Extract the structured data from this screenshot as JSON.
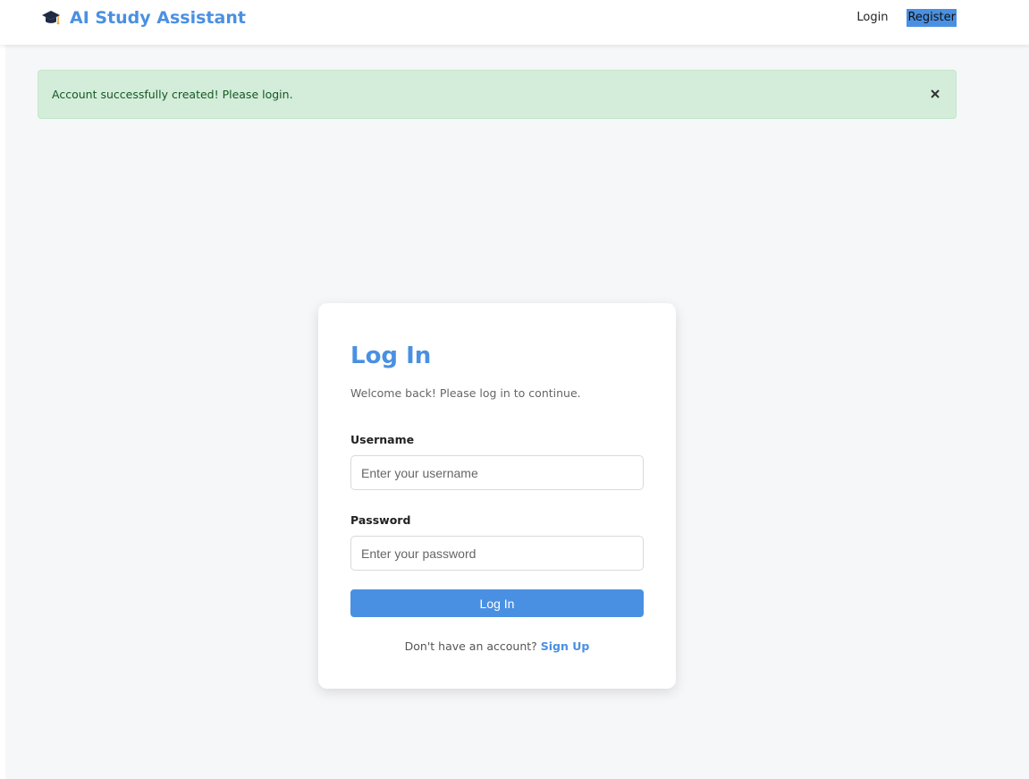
{
  "navbar": {
    "brand": "AI Study Assistant",
    "brand_icon": "graduation-cap-icon",
    "login_label": "Login",
    "register_label": "Register"
  },
  "alert": {
    "message": "Account successfully created! Please login.",
    "close_icon": "close-icon",
    "type": "success"
  },
  "login_form": {
    "title": "Log In",
    "subtitle": "Welcome back! Please log in to continue.",
    "username_label": "Username",
    "username_placeholder": "Enter your username",
    "username_value": "",
    "password_label": "Password",
    "password_placeholder": "Enter your password",
    "password_value": "",
    "submit_label": "Log In",
    "signup_prompt": "Don't have an account?",
    "signup_link": "Sign Up"
  },
  "colors": {
    "accent": "#4a90e2",
    "alert_bg": "#d4edda",
    "alert_text": "#155724",
    "page_bg": "#f6f7f9"
  }
}
